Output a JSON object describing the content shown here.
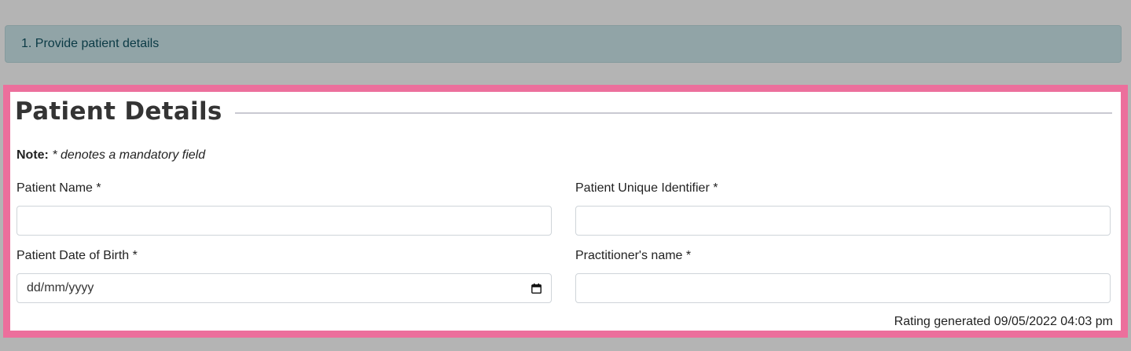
{
  "step_banner": {
    "text": "1. Provide patient details"
  },
  "panel": {
    "title": "Patient Details",
    "note": {
      "label": "Note:",
      "text": "* denotes a mandatory field"
    },
    "fields": {
      "patient_name": {
        "label": "Patient Name *",
        "value": "",
        "placeholder": ""
      },
      "patient_unique_identifier": {
        "label": "Patient Unique Identifier *",
        "value": "",
        "placeholder": ""
      },
      "patient_dob": {
        "label": "Patient Date of Birth *",
        "value": "",
        "placeholder": "dd/mm/yyyy"
      },
      "practitioner_name": {
        "label": "Practitioner's name *",
        "value": "",
        "placeholder": ""
      }
    },
    "footer": {
      "rating_generated": "Rating generated 09/05/2022 04:03 pm"
    }
  },
  "colors": {
    "page_background": "#b4b4b4",
    "banner_background": "#91a4a7",
    "banner_text": "#0b3a45",
    "panel_border": "#ec6f9c",
    "panel_background": "#ffffff"
  },
  "icons": {
    "date_picker": "calendar-icon"
  }
}
